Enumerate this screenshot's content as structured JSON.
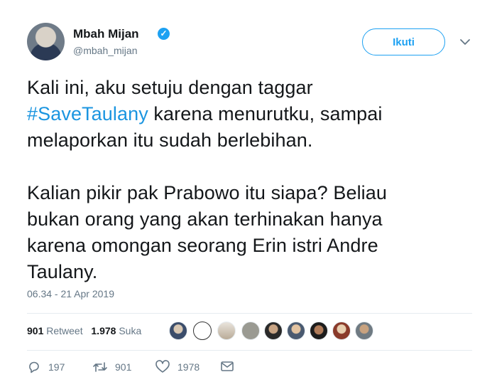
{
  "user": {
    "name": "Mbah Mijan",
    "handle": "@mbah_mijan",
    "verified_mark": "✓"
  },
  "follow_button": {
    "label": "Ikuti"
  },
  "tweet": {
    "line1": "Kali ini, aku setuju dengan taggar",
    "hashtag": "#SaveTaulany",
    "line2_rest": " karena menurutku, sampai",
    "line3": "melaporkan itu sudah berlebihan.",
    "line4": "Kalian pikir pak Prabowo itu siapa? Beliau",
    "line5": "bukan orang yang akan terhinakan hanya",
    "line6": "karena omongan seorang Erin istri Andre",
    "line7": "Taulany."
  },
  "timestamp": "06.34 - 21 Apr 2019",
  "stats": {
    "retweet_count": "901",
    "retweet_label": "Retweet",
    "like_count": "1.978",
    "like_label": "Suka"
  },
  "actions": {
    "reply_count": "197",
    "retweet_count": "901",
    "like_count": "1978"
  },
  "icons": {
    "verified": "verified-badge-icon",
    "chevron": "chevron-down-icon",
    "reply": "reply-icon",
    "retweet": "retweet-icon",
    "like": "heart-icon",
    "message": "direct-message-icon"
  },
  "colors": {
    "accent": "#1da1f2",
    "hashtag": "#1b95e0",
    "muted": "#657786",
    "text": "#14171a"
  }
}
